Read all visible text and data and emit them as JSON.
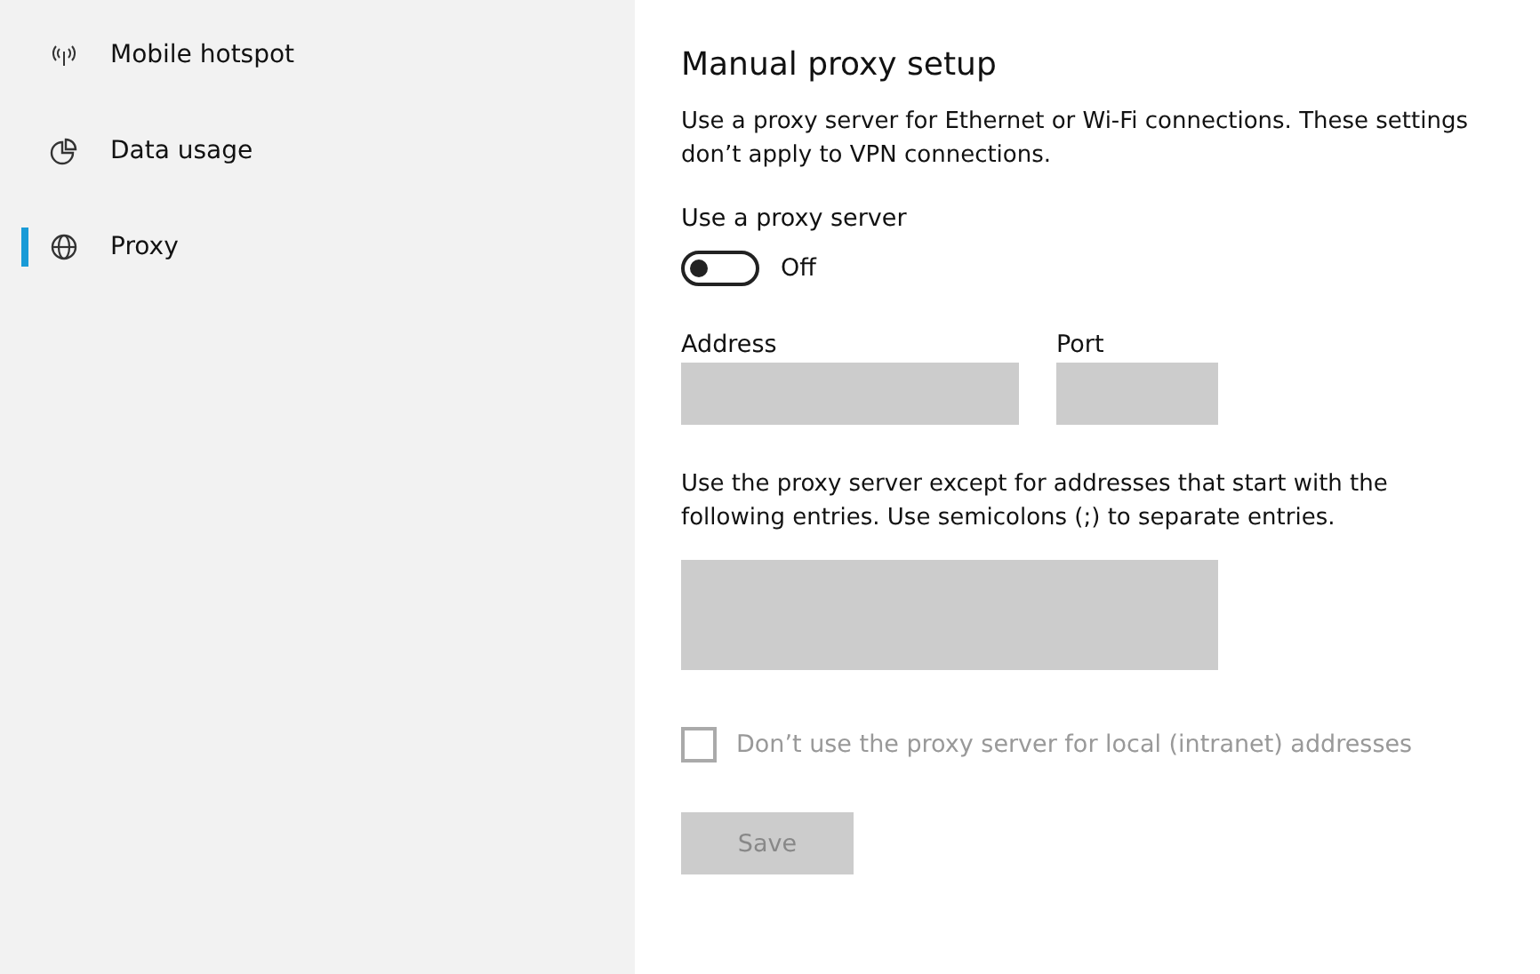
{
  "sidebar": {
    "items": [
      {
        "label": "Mobile hotspot",
        "kind": "hotspot",
        "selected": false
      },
      {
        "label": "Data usage",
        "kind": "pie",
        "selected": false
      },
      {
        "label": "Proxy",
        "kind": "globe",
        "selected": true
      }
    ]
  },
  "main": {
    "title": "Manual proxy setup",
    "description": "Use a proxy server for Ethernet or Wi-Fi connections. These settings don’t apply to VPN connections.",
    "toggle": {
      "label": "Use a proxy server",
      "on": false,
      "state_text": "Off"
    },
    "address": {
      "label": "Address"
    },
    "port": {
      "label": "Port"
    },
    "exceptions": {
      "description": "Use the proxy server except for addresses that start with the following entries. Use semicolons (;) to separate entries."
    },
    "local_checkbox": {
      "label": "Don’t use the proxy server for local (intranet) addresses",
      "checked": false,
      "disabled": true
    },
    "save_button": {
      "label": "Save",
      "disabled": true
    }
  }
}
